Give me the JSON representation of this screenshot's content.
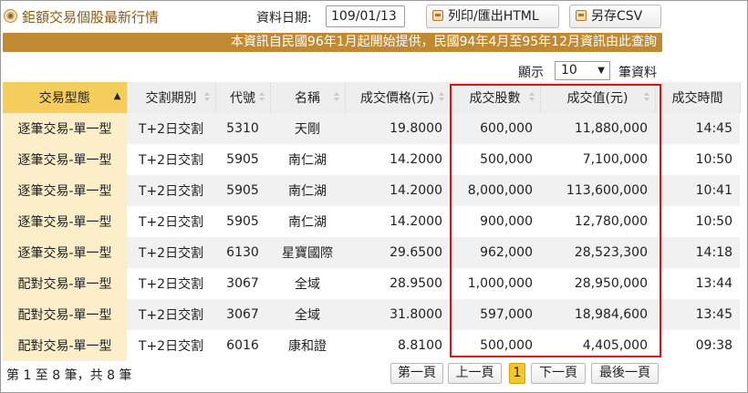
{
  "header": {
    "title": "鉅額交易個股最新行情",
    "title_icon": "bullet-icon",
    "date_label": "資料日期:",
    "date_value": "109/01/13",
    "print_label": "列印/匯出HTML",
    "save_csv_label": "另存CSV",
    "print_icon": "printer-icon",
    "save_icon": "save-icon"
  },
  "notice": "本資訊自民國96年1月起開始提供，民國94年4月至95年12月資訊由此查詢",
  "display": {
    "prefix": "顯示",
    "selected": "10",
    "suffix": "筆資料"
  },
  "table": {
    "columns": [
      "交易型態",
      "交割期別",
      "代號",
      "名稱",
      "成交價格(元)",
      "成交股數",
      "成交值(元)",
      "成交時間"
    ],
    "sorted_column": 0,
    "sort_direction": "ascending",
    "rows": [
      [
        "逐筆交易-單一型",
        "T+2日交割",
        "5310",
        "天剛",
        "19.8000",
        "600,000",
        "11,880,000",
        "14:45"
      ],
      [
        "逐筆交易-單一型",
        "T+2日交割",
        "5905",
        "南仁湖",
        "14.2000",
        "500,000",
        "7,100,000",
        "10:50"
      ],
      [
        "逐筆交易-單一型",
        "T+2日交割",
        "5905",
        "南仁湖",
        "14.2000",
        "8,000,000",
        "113,600,000",
        "10:41"
      ],
      [
        "逐筆交易-單一型",
        "T+2日交割",
        "5905",
        "南仁湖",
        "14.2000",
        "900,000",
        "12,780,000",
        "10:50"
      ],
      [
        "逐筆交易-單一型",
        "T+2日交割",
        "6130",
        "星寶國際",
        "29.6500",
        "962,000",
        "28,523,300",
        "14:18"
      ],
      [
        "配對交易-單一型",
        "T+2日交割",
        "3067",
        "全域",
        "28.9500",
        "1,000,000",
        "28,950,000",
        "13:44"
      ],
      [
        "配對交易-單一型",
        "T+2日交割",
        "3067",
        "全域",
        "31.8000",
        "597,000",
        "18,984,600",
        "13:45"
      ],
      [
        "配對交易-單一型",
        "T+2日交割",
        "6016",
        "康和證",
        "8.8100",
        "500,000",
        "4,405,000",
        "09:38"
      ]
    ]
  },
  "footer": {
    "info": "第 1 至 8 筆，共 8 筆",
    "first": "第一頁",
    "prev": "上一頁",
    "current_page": "1",
    "next": "下一頁",
    "last": "最後一頁"
  },
  "colors": {
    "accent_brown": "#c08a33",
    "sorted_header": "#f4cd5c",
    "type_cell": "#fbeec8",
    "highlight_border": "#e01010",
    "active_page": "#f7c628"
  }
}
